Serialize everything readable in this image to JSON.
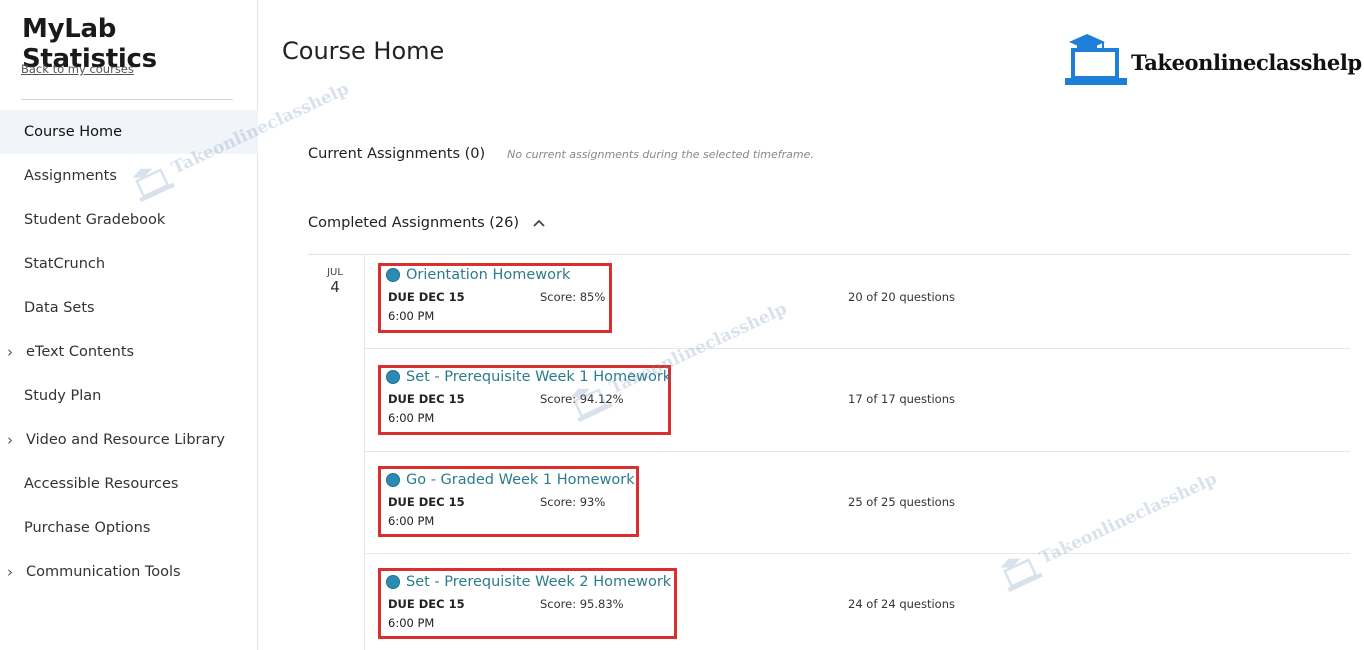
{
  "sidebar": {
    "app_title": "MyLab Statistics",
    "back_link": "Back to my courses",
    "items": [
      {
        "label": "Course Home",
        "active": true,
        "chevron": false
      },
      {
        "label": "Assignments",
        "active": false,
        "chevron": false
      },
      {
        "label": "Student Gradebook",
        "active": false,
        "chevron": false
      },
      {
        "label": "StatCrunch",
        "active": false,
        "chevron": false
      },
      {
        "label": "Data Sets",
        "active": false,
        "chevron": false
      },
      {
        "label": "eText Contents",
        "active": false,
        "chevron": true
      },
      {
        "label": "Study Plan",
        "active": false,
        "chevron": false
      },
      {
        "label": "Video and Resource Library",
        "active": false,
        "chevron": true
      },
      {
        "label": "Accessible Resources",
        "active": false,
        "chevron": false
      },
      {
        "label": "Purchase Options",
        "active": false,
        "chevron": false
      },
      {
        "label": "Communication Tools",
        "active": false,
        "chevron": true
      }
    ]
  },
  "main": {
    "page_title": "Course Home",
    "logo_text": "Takeonlineclasshelp",
    "watermark_text": "Takeonlineclasshelp",
    "current": {
      "label": "Current Assignments (0)",
      "note": "No current assignments during the selected timeframe."
    },
    "completed": {
      "label": "Completed Assignments (26)",
      "date_month": "JUL",
      "date_day": "4",
      "assignments": [
        {
          "title": "Orientation Homework",
          "due": "DUE DEC 15",
          "time": "6:00 PM",
          "score": "Score: 85%",
          "questions": "20 of 20 questions"
        },
        {
          "title": "Set - Prerequisite Week 1 Homework",
          "due": "DUE DEC 15",
          "time": "6:00 PM",
          "score": "Score: 94.12%",
          "questions": "17 of 17 questions"
        },
        {
          "title": "Go - Graded Week 1 Homework",
          "due": "DUE DEC 15",
          "time": "6:00 PM",
          "score": "Score: 93%",
          "questions": "25 of 25 questions"
        },
        {
          "title": "Set - Prerequisite Week 2 Homework",
          "due": "DUE DEC 15",
          "time": "6:00 PM",
          "score": "Score: 95.83%",
          "questions": "24 of 24 questions"
        }
      ]
    }
  },
  "colors": {
    "accent_link": "#2b7c8c",
    "status_dot": "#2b8bb3",
    "highlight_box": "#d9302f",
    "active_nav_bg": "#f1f4f8",
    "logo_blue": "#1e7fd9"
  }
}
